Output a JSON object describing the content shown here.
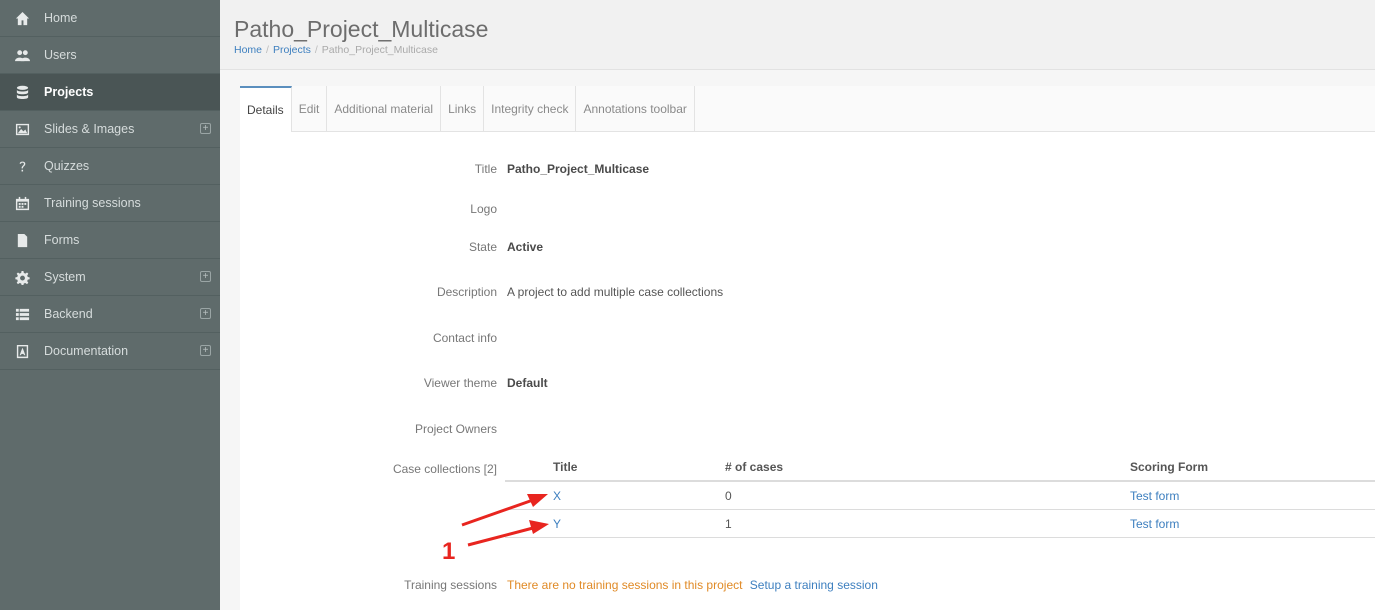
{
  "sidebar": {
    "items": [
      {
        "label": "Home",
        "icon": "home-icon",
        "expand": false,
        "active": false
      },
      {
        "label": "Users",
        "icon": "users-icon",
        "expand": false,
        "active": false
      },
      {
        "label": "Projects",
        "icon": "database-icon",
        "expand": false,
        "active": true
      },
      {
        "label": "Slides & Images",
        "icon": "image-icon",
        "expand": true,
        "active": false
      },
      {
        "label": "Quizzes",
        "icon": "question-icon",
        "expand": false,
        "active": false
      },
      {
        "label": "Training sessions",
        "icon": "calendar-icon",
        "expand": false,
        "active": false
      },
      {
        "label": "Forms",
        "icon": "file-icon",
        "expand": false,
        "active": false
      },
      {
        "label": "System",
        "icon": "gear-icon",
        "expand": true,
        "active": false
      },
      {
        "label": "Backend",
        "icon": "list-icon",
        "expand": true,
        "active": false
      },
      {
        "label": "Documentation",
        "icon": "pdf-icon",
        "expand": true,
        "active": false
      }
    ],
    "expand_symbol": "+"
  },
  "header": {
    "title": "Patho_Project_Multicase",
    "breadcrumb": {
      "home": "Home",
      "sep": "/",
      "projects": "Projects",
      "current": "Patho_Project_Multicase"
    }
  },
  "tabs": [
    "Details",
    "Edit",
    "Additional material",
    "Links",
    "Integrity check",
    "Annotations toolbar"
  ],
  "details": {
    "title_label": "Title",
    "title_value": "Patho_Project_Multicase",
    "logo_label": "Logo",
    "state_label": "State",
    "state_value": "Active",
    "description_label": "Description",
    "description_value": "A project to add multiple case collections",
    "contact_label": "Contact info",
    "theme_label": "Viewer theme",
    "theme_value": "Default",
    "owners_label": "Project Owners",
    "collections_label": "Case collections [2]",
    "training_label": "Training sessions",
    "training_empty": "There are no training sessions in this project",
    "training_setup": "Setup a training session"
  },
  "collections": {
    "headers": [
      "Title",
      "# of cases",
      "Scoring Form"
    ],
    "rows": [
      {
        "title": "X",
        "cases": "0",
        "form": "Test form"
      },
      {
        "title": "Y",
        "cases": "1",
        "form": "Test form"
      }
    ]
  },
  "annotation": {
    "label": "1",
    "color": "#e8251f"
  }
}
